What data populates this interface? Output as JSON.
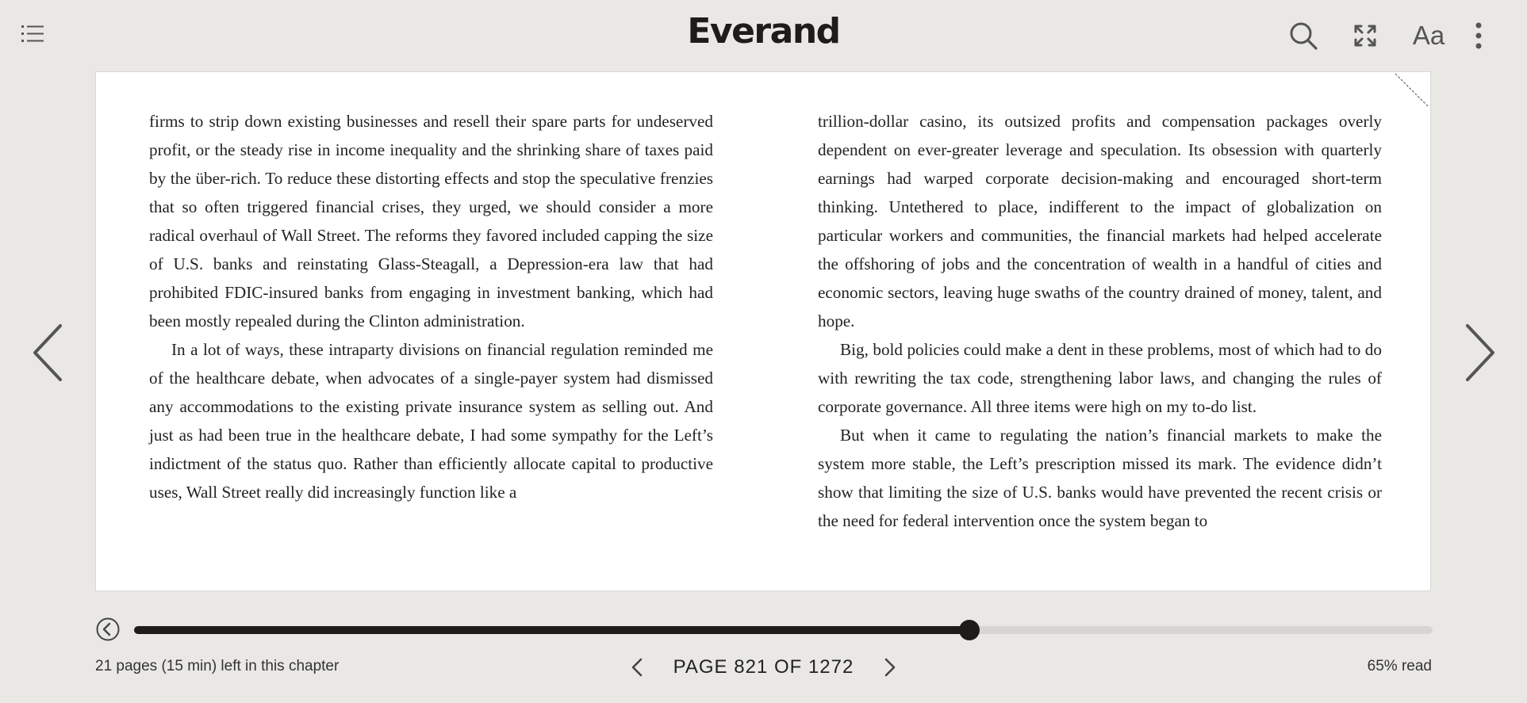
{
  "header": {
    "logo": "Everand"
  },
  "icons": {
    "toc": "list-icon",
    "search": "search-icon",
    "fullscreen": "fullscreen-icon",
    "font": "Aa",
    "more": "more-vertical-icon"
  },
  "book": {
    "left_paragraphs": [
      "firms to strip down existing businesses and resell their spare parts for unde­served profit, or the steady rise in income inequality and the shrinking share of taxes paid by the über-rich. To reduce these distorting effects and stop the speculative frenzies that so often triggered financial crises, they urged, we should consider a more radical overhaul of Wall Street. The reforms they fa­vored included capping the size of U.S. banks and reinstating Glass-Steagall, a Depression-era law that had prohibited FDIC-insured banks from engaging in investment banking, which had been mostly repealed during the Clinton admi­nistration.",
      "In a lot of ways, these intraparty divisions on financial regulation reminded me of the healthcare debate, when advocates of a single-payer system had dis­missed any accommodations to the existing private insurance system as selling out. And just as had been true in the healthcare debate, I had some sympathy for the Left’s indictment of the status quo. Rather than efficiently allocate cap­ital to productive uses, Wall Street really did increasingly function like a"
    ],
    "right_paragraphs": [
      "trillion-dollar casino, its outsized profits and compensation packages overly dependent on ever-greater leverage and speculation. Its obsession with quar­terly earnings had warped corporate decision-making and encouraged short-term thinking. Untethered to place, indifferent to the impact of globalization on particular workers and communities, the financial markets had helped accel­erate the offshoring of jobs and the concentration of wealth in a handful of cities and economic sectors, leaving huge swaths of the country drained of money, talent, and hope.",
      "Big, bold policies could make a dent in these problems, most of which had to do with rewriting the tax code, strengthening labor laws, and changing the rules of corporate governance. All three items were high on my to-do list.",
      "But when it came to regulating the nation’s financial markets to make the system more stable, the Left’s prescription missed its mark. The evidence didn’t show that limiting the size of U.S. banks would have prevented the re­cent crisis or the need for federal intervention once the system began to"
    ]
  },
  "progress": {
    "fraction": 0.643,
    "chapter_left": "21 pages (15 min) left in this chapter",
    "page_label": "PAGE 821 OF 1272",
    "percent_read": "65% read"
  },
  "colors": {
    "background": "#e9e8e5",
    "ink": "#1e1b18",
    "page": "#ffffff",
    "track": "#d6d5d2"
  }
}
